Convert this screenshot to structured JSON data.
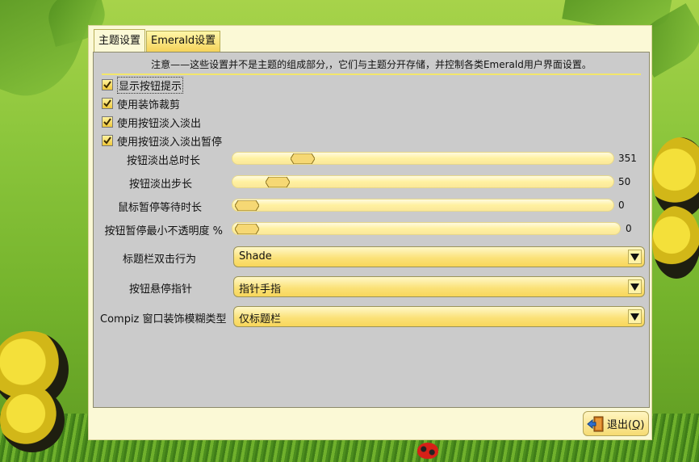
{
  "tabs": [
    {
      "label": "主题设置",
      "active": true
    },
    {
      "label": "Emerald设置",
      "active": false
    }
  ],
  "notice": "注意——这些设置并不是主题的组成部分,，它们与主题分开存储，并控制各类Emerald用户界面设置。",
  "checkboxes": [
    {
      "label": "显示按钮提示",
      "checked": true
    },
    {
      "label": "使用装饰裁剪",
      "checked": true
    },
    {
      "label": "使用按钮淡入淡出",
      "checked": true
    },
    {
      "label": "使用按钮淡入淡出暂停",
      "checked": true
    }
  ],
  "sliders": [
    {
      "label": "按钮淡出总时长",
      "value": "351",
      "fraction": 0.08
    },
    {
      "label": "按钮淡出步长",
      "value": "50",
      "fraction": 0.01
    },
    {
      "label": "鼠标暂停等待时长",
      "value": "0",
      "fraction": 0.0
    },
    {
      "label": "按钮暂停最小不透明度 %",
      "value": "0",
      "fraction": 0.0
    }
  ],
  "combos": [
    {
      "label": "标题栏双击行为",
      "value": "Shade"
    },
    {
      "label": "按钮悬停指针",
      "value": "指针手指"
    },
    {
      "label": "Compiz 窗口装饰模糊类型",
      "value": "仅标题栏"
    }
  ],
  "quit_button": {
    "label": "退出(",
    "mnemonic": "Q",
    "suffix": ")"
  },
  "colors": {
    "accent": "#f5d35a",
    "panel": "#cbcbcb",
    "window": "#fbf9d6"
  },
  "icons": [
    "checkmark-icon",
    "slider-knob-icon",
    "dropdown-arrow-icon",
    "exit-door-icon"
  ]
}
